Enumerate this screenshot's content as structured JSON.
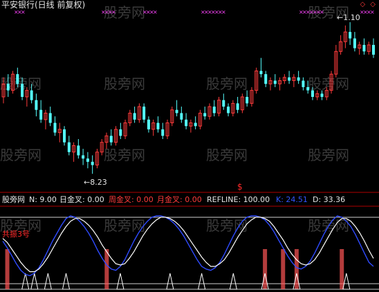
{
  "chart_data": [
    {
      "type": "candlestick",
      "title": "平安银行(日线 前复权)",
      "annotations": {
        "high": "1.10",
        "low": "8.23"
      },
      "ohlc": [
        [
          10.6,
          11.2,
          10.4,
          11.0
        ],
        [
          11.0,
          11.3,
          10.6,
          10.8
        ],
        [
          10.8,
          11.4,
          10.7,
          11.3
        ],
        [
          11.3,
          11.5,
          10.9,
          11.0
        ],
        [
          11.0,
          11.2,
          10.5,
          10.6
        ],
        [
          10.6,
          10.9,
          10.3,
          10.8
        ],
        [
          10.8,
          11.0,
          10.4,
          10.5
        ],
        [
          10.5,
          10.7,
          10.0,
          10.2
        ],
        [
          10.2,
          10.5,
          9.8,
          9.9
        ],
        [
          9.9,
          10.2,
          9.6,
          10.1
        ],
        [
          10.1,
          10.3,
          9.7,
          9.8
        ],
        [
          9.8,
          10.0,
          9.4,
          9.5
        ],
        [
          9.5,
          9.8,
          9.2,
          9.6
        ],
        [
          9.6,
          9.7,
          9.1,
          9.2
        ],
        [
          9.2,
          9.4,
          8.8,
          8.9
        ],
        [
          8.9,
          9.2,
          8.6,
          9.1
        ],
        [
          9.1,
          9.3,
          8.7,
          8.8
        ],
        [
          8.8,
          9.0,
          8.5,
          8.7
        ],
        [
          8.7,
          8.9,
          8.4,
          8.6
        ],
        [
          8.6,
          8.8,
          8.23,
          8.5
        ],
        [
          8.5,
          9.0,
          8.4,
          8.9
        ],
        [
          8.9,
          9.3,
          8.8,
          9.2
        ],
        [
          9.2,
          9.5,
          9.0,
          9.4
        ],
        [
          9.4,
          9.6,
          9.1,
          9.2
        ],
        [
          9.2,
          9.7,
          9.1,
          9.6
        ],
        [
          9.6,
          9.8,
          9.3,
          9.4
        ],
        [
          9.4,
          9.9,
          9.3,
          9.8
        ],
        [
          9.8,
          10.2,
          9.7,
          10.1
        ],
        [
          10.1,
          10.3,
          9.8,
          9.9
        ],
        [
          9.9,
          10.4,
          9.8,
          10.3
        ],
        [
          10.3,
          10.4,
          9.8,
          9.9
        ],
        [
          9.9,
          10.0,
          9.5,
          9.6
        ],
        [
          9.6,
          9.9,
          9.4,
          9.8
        ],
        [
          9.8,
          10.0,
          9.5,
          9.6
        ],
        [
          9.6,
          9.8,
          9.3,
          9.4
        ],
        [
          9.4,
          9.9,
          9.3,
          9.8
        ],
        [
          9.8,
          10.3,
          9.7,
          10.2
        ],
        [
          10.2,
          10.5,
          10.0,
          10.1
        ],
        [
          10.1,
          10.3,
          9.8,
          9.9
        ],
        [
          9.9,
          10.1,
          9.6,
          9.7
        ],
        [
          9.7,
          9.9,
          9.5,
          9.8
        ],
        [
          9.8,
          10.0,
          9.6,
          9.7
        ],
        [
          9.7,
          10.2,
          9.6,
          10.1
        ],
        [
          10.1,
          10.3,
          9.9,
          10.0
        ],
        [
          10.0,
          10.4,
          9.9,
          10.3
        ],
        [
          10.3,
          10.5,
          10.0,
          10.1
        ],
        [
          10.1,
          10.6,
          10.0,
          10.5
        ],
        [
          10.5,
          10.7,
          10.2,
          10.3
        ],
        [
          10.3,
          10.4,
          10.0,
          10.1
        ],
        [
          10.1,
          10.5,
          10.0,
          10.4
        ],
        [
          10.4,
          10.6,
          10.1,
          10.2
        ],
        [
          10.2,
          10.7,
          10.1,
          10.6
        ],
        [
          10.6,
          10.8,
          10.3,
          10.4
        ],
        [
          10.4,
          10.9,
          10.3,
          10.8
        ],
        [
          10.8,
          11.5,
          10.7,
          11.4
        ],
        [
          11.4,
          11.8,
          11.2,
          11.3
        ],
        [
          11.3,
          11.4,
          10.9,
          11.0
        ],
        [
          11.0,
          11.2,
          10.8,
          11.1
        ],
        [
          11.1,
          11.3,
          10.9,
          11.0
        ],
        [
          11.0,
          11.2,
          10.8,
          11.1
        ],
        [
          11.1,
          11.3,
          11.0,
          11.2
        ],
        [
          11.2,
          11.4,
          11.0,
          11.1
        ],
        [
          11.1,
          11.3,
          10.9,
          11.2
        ],
        [
          11.2,
          11.4,
          11.0,
          11.1
        ],
        [
          11.1,
          11.2,
          10.8,
          10.9
        ],
        [
          10.9,
          11.1,
          10.7,
          10.8
        ],
        [
          10.8,
          10.9,
          10.5,
          10.6
        ],
        [
          10.6,
          10.8,
          10.5,
          10.7
        ],
        [
          10.7,
          10.8,
          10.5,
          10.6
        ],
        [
          10.6,
          10.9,
          10.5,
          10.8
        ],
        [
          10.8,
          11.4,
          10.7,
          11.3
        ],
        [
          11.3,
          12.2,
          11.2,
          12.0
        ],
        [
          12.0,
          12.5,
          11.9,
          12.3
        ],
        [
          12.3,
          12.8,
          12.1,
          12.6
        ],
        [
          12.6,
          12.9,
          12.2,
          12.4
        ],
        [
          12.4,
          12.6,
          12.0,
          12.1
        ],
        [
          12.1,
          12.3,
          11.9,
          12.2
        ],
        [
          12.2,
          12.4,
          11.9,
          12.0
        ],
        [
          12.0,
          12.3,
          11.9,
          12.2
        ],
        [
          12.2,
          12.4,
          11.8,
          11.9
        ]
      ]
    },
    {
      "type": "line",
      "indicator": "股旁网",
      "params": [
        {
          "label": "N: 9.00",
          "color": "#e6e6e6"
        },
        {
          "label": "日金叉: 0.00",
          "color": "#e6e6e6"
        },
        {
          "label": "周金叉: 0.00",
          "color": "#ff3b3b"
        },
        {
          "label": "月金叉: 0.00",
          "color": "#ff3b3b"
        },
        {
          "label": "REFLINE: 100.00",
          "color": "#e6e6e6"
        },
        {
          "label": "K: 24.51",
          "color": "#3355ff"
        },
        {
          "label": "D: 33.36",
          "color": "#e6e6e6"
        }
      ],
      "ylim": [
        0,
        100
      ],
      "refline": 100,
      "k": [
        62,
        52,
        40,
        28,
        18,
        12,
        10,
        14,
        22,
        34,
        48,
        62,
        74,
        86,
        96,
        100,
        98,
        92,
        84,
        74,
        62,
        48,
        36,
        26,
        20,
        18,
        24,
        34,
        48,
        62,
        74,
        84,
        92,
        98,
        100,
        100,
        98,
        94,
        88,
        80,
        70,
        58,
        46,
        34,
        24,
        20,
        18,
        22,
        30,
        42,
        56,
        70,
        82,
        92,
        98,
        100,
        100,
        98,
        94,
        86,
        76,
        64,
        52,
        40,
        30,
        22,
        20,
        24,
        32,
        44,
        58,
        72,
        84,
        94,
        100,
        98,
        92,
        84,
        72,
        58,
        44,
        30,
        24
      ],
      "d": [
        66,
        60,
        50,
        40,
        30,
        22,
        16,
        16,
        20,
        28,
        38,
        50,
        62,
        74,
        84,
        92,
        96,
        96,
        92,
        86,
        78,
        68,
        56,
        46,
        36,
        28,
        26,
        28,
        36,
        46,
        58,
        70,
        80,
        88,
        94,
        98,
        98,
        96,
        92,
        86,
        78,
        68,
        58,
        48,
        38,
        30,
        24,
        24,
        28,
        34,
        44,
        56,
        68,
        78,
        88,
        94,
        98,
        98,
        96,
        92,
        84,
        74,
        64,
        52,
        42,
        34,
        28,
        26,
        28,
        34,
        44,
        56,
        68,
        80,
        90,
        96,
        96,
        92,
        84,
        74,
        62,
        48,
        36
      ],
      "gongzhen_label": "共振3号",
      "gongzhen_signal": "$",
      "red_bars": [
        1,
        23,
        58,
        62,
        65,
        75
      ],
      "white_triangles": [
        5,
        7,
        10,
        14,
        26,
        37,
        44,
        51,
        58,
        65,
        76
      ]
    }
  ],
  "ui": {
    "title": "平安银行(日线 前复权)",
    "diamonds": "◇ ◇",
    "watermark": "股旁网"
  }
}
